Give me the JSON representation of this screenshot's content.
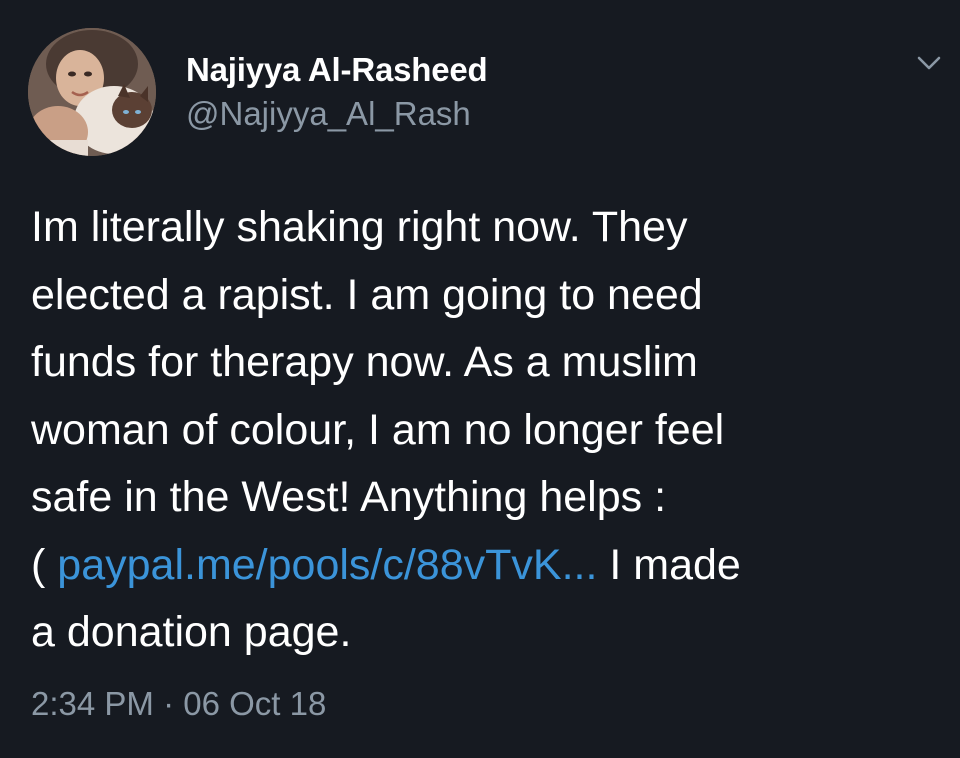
{
  "user": {
    "display_name": "Najiyya Al-Rasheed",
    "handle": "@Najiyya_Al_Rash",
    "avatar_icon": "profile-photo-with-cat"
  },
  "tweet": {
    "text_before_link": "Im literally shaking right now. They\nelected a rapist. I am going to need\nfunds for therapy now. As a muslim\nwoman of colour, I am no longer feel\nsafe in the West! Anything helps :\n( ",
    "link_text": "paypal.me/pools/c/88vTvK...",
    "text_after_link": " I made\na donation page.",
    "timestamp": "2:34 PM · 06 Oct 18"
  },
  "menu": {
    "icon": "chevron-down-icon"
  },
  "colors": {
    "background": "#161a21",
    "text": "#ffffff",
    "secondary": "#8b98a5",
    "link": "#3b94d9"
  }
}
